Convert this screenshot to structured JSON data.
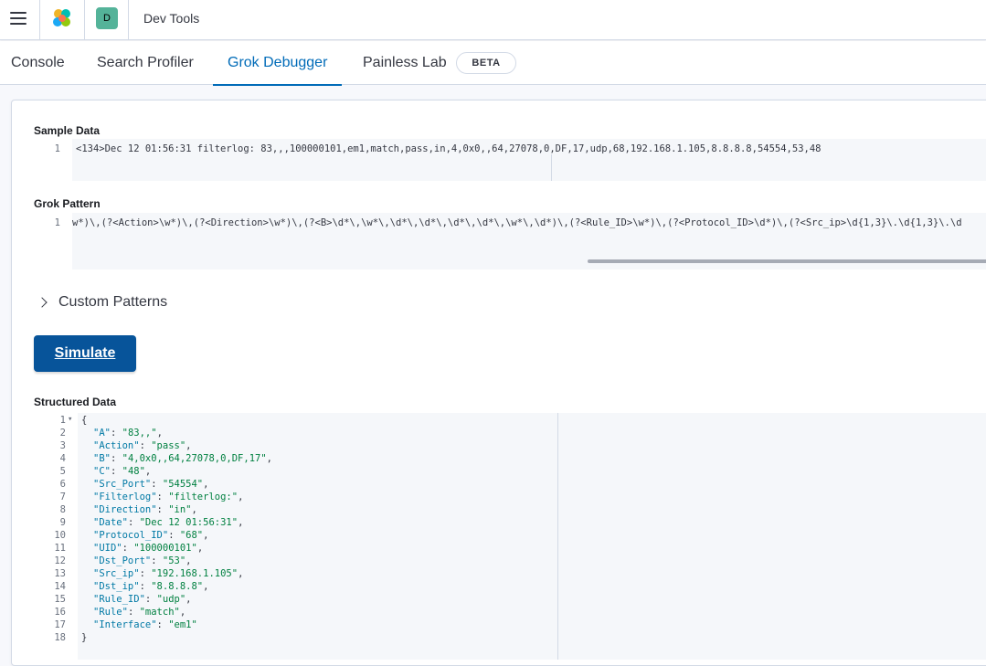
{
  "header": {
    "app_title": "Dev Tools",
    "space_initial": "D",
    "menu_icon": "hamburger-icon",
    "logo_icon": "elastic-logo-icon"
  },
  "tabs": [
    {
      "label": "Console",
      "active": false
    },
    {
      "label": "Search Profiler",
      "active": false
    },
    {
      "label": "Grok Debugger",
      "active": true
    },
    {
      "label": "Painless Lab",
      "active": false
    }
  ],
  "beta_badge": "BETA",
  "sample_data": {
    "label": "Sample Data",
    "line_number": "1",
    "value": "<134>Dec 12 01:56:31 filterlog: 83,,,100000101,em1,match,pass,in,4,0x0,,64,27078,0,DF,17,udp,68,192.168.1.105,8.8.8.8,54554,53,48"
  },
  "grok_pattern": {
    "label": "Grok Pattern",
    "line_number": "1",
    "value": "w*)\\,(?<Action>\\w*)\\,(?<Direction>\\w*)\\,(?<B>\\d*\\,\\w*\\,\\d*\\,\\d*\\,\\d*\\,\\d*\\,\\w*\\,\\d*)\\,(?<Rule_ID>\\w*)\\,(?<Protocol_ID>\\d*)\\,(?<Src_ip>\\d{1,3}\\.\\d{1,3}\\.\\d"
  },
  "custom_patterns": {
    "label": "Custom Patterns",
    "icon": "chevron-right-icon"
  },
  "simulate_button": "Simulate",
  "structured_data": {
    "label": "Structured Data",
    "open_brace": "{",
    "close_brace": "}",
    "fields": [
      {
        "key": "\"A\"",
        "value": "\"83,,\""
      },
      {
        "key": "\"Action\"",
        "value": "\"pass\""
      },
      {
        "key": "\"B\"",
        "value": "\"4,0x0,,64,27078,0,DF,17\""
      },
      {
        "key": "\"C\"",
        "value": "\"48\""
      },
      {
        "key": "\"Src_Port\"",
        "value": "\"54554\""
      },
      {
        "key": "\"Filterlog\"",
        "value": "\"filterlog:\""
      },
      {
        "key": "\"Direction\"",
        "value": "\"in\""
      },
      {
        "key": "\"Date\"",
        "value": "\"Dec 12 01:56:31\""
      },
      {
        "key": "\"Protocol_ID\"",
        "value": "\"68\""
      },
      {
        "key": "\"UID\"",
        "value": "\"100000101\""
      },
      {
        "key": "\"Dst_Port\"",
        "value": "\"53\""
      },
      {
        "key": "\"Src_ip\"",
        "value": "\"192.168.1.105\""
      },
      {
        "key": "\"Dst_ip\"",
        "value": "\"8.8.8.8\""
      },
      {
        "key": "\"Rule_ID\"",
        "value": "\"udp\""
      },
      {
        "key": "\"Rule\"",
        "value": "\"match\""
      },
      {
        "key": "\"Interface\"",
        "value": "\"em1\""
      }
    ],
    "line_numbers": [
      "1",
      "2",
      "3",
      "4",
      "5",
      "6",
      "7",
      "8",
      "9",
      "10",
      "11",
      "12",
      "13",
      "14",
      "15",
      "16",
      "17",
      "18"
    ]
  },
  "colors": {
    "accent": "#006bb8",
    "button": "#07549a",
    "json_key": "#0079a5",
    "json_string": "#008040"
  }
}
